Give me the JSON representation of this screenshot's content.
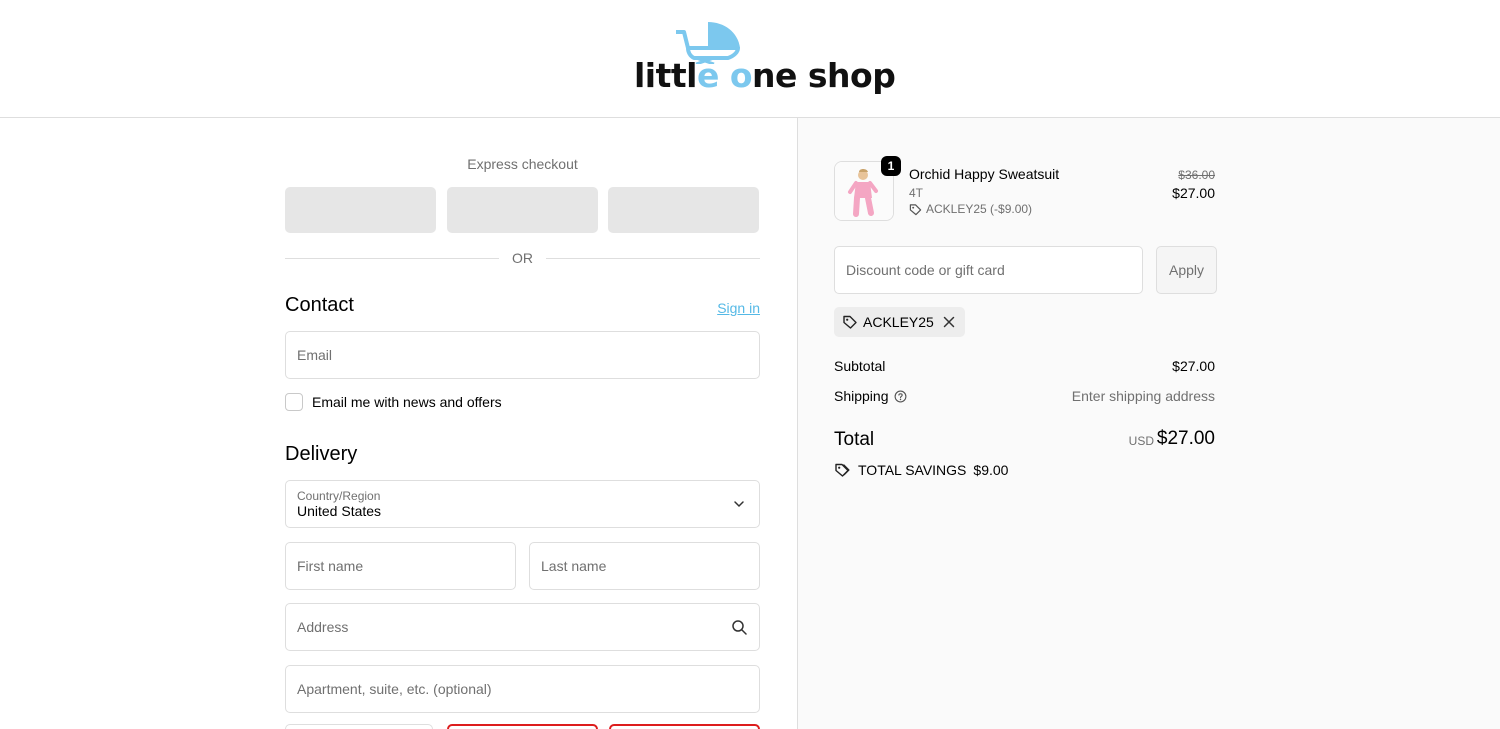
{
  "brand": {
    "logo_text_dark_1": "littl",
    "logo_text_blue_1": "e",
    "logo_text_dark_2": " ",
    "logo_text_blue_2": "o",
    "logo_text_dark_3": "ne shop",
    "logo_color": "#7cc8ee"
  },
  "express": {
    "title": "Express checkout",
    "or": "OR"
  },
  "contact": {
    "heading": "Contact",
    "sign_in": "Sign in",
    "email_placeholder": "Email",
    "news_checkbox_label": "Email me with news and offers",
    "news_checked": false
  },
  "delivery": {
    "heading": "Delivery",
    "country_label": "Country/Region",
    "country_value": "United States",
    "first_name_placeholder": "First name",
    "last_name_placeholder": "Last name",
    "address_placeholder": "Address",
    "apartment_placeholder": "Apartment, suite, etc. (optional)"
  },
  "order": {
    "item": {
      "quantity": "1",
      "name": "Orchid Happy Sweatsuit",
      "variant": "4T",
      "discount": "ACKLEY25 (-$9.00)",
      "price_original": "$36.00",
      "price": "$27.00"
    },
    "discount_placeholder": "Discount code or gift card",
    "apply_label": "Apply",
    "applied_code": "ACKLEY25",
    "subtotal_label": "Subtotal",
    "subtotal_value": "$27.00",
    "shipping_label": "Shipping",
    "shipping_value": "Enter shipping address",
    "total_label": "Total",
    "currency": "USD",
    "total_value": "$27.00",
    "savings_label": "TOTAL SAVINGS",
    "savings_value": "$9.00"
  },
  "colors": {
    "link": "#55b9e6",
    "error_border": "#dd1d1d",
    "sidebar_bg": "#fafafa"
  }
}
